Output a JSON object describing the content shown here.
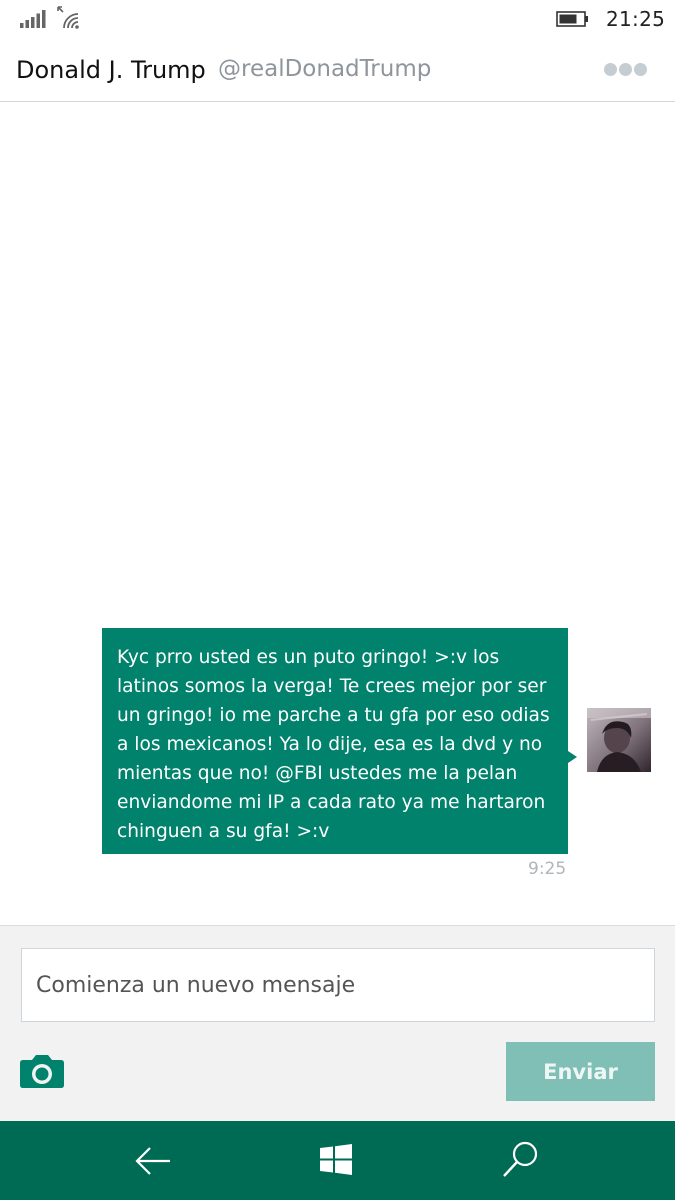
{
  "status_bar": {
    "time": "21:25",
    "icons": [
      "signal-icon",
      "wifi-icon",
      "battery-icon"
    ]
  },
  "header": {
    "name": "Donald J. Trump",
    "handle": "@realDonadTrump",
    "more_icon": "more-icon"
  },
  "conversation": {
    "messages": [
      {
        "text": "Kyc prro usted es un puto gringo! >:v los latinos somos la verga! Te crees mejor por ser un gringo! io me parche a tu gfa por eso odias a los mexicanos! Ya lo dije, esa es la dvd y no mientas que no! @FBI ustedes me la pelan enviandome mi IP a cada rato ya me hartaron chinguen a su gfa! >:v",
        "time": "9:25"
      }
    ]
  },
  "compose": {
    "placeholder": "Comienza un nuevo mensaje",
    "camera_icon": "camera-icon",
    "send_label": "Enviar"
  },
  "nav_bar": {
    "icons": [
      "back-icon",
      "windows-start-icon",
      "search-icon"
    ]
  },
  "colors": {
    "accent": "#00826d",
    "nav_bar": "#006b54",
    "send_disabled": "#80bfb5"
  }
}
